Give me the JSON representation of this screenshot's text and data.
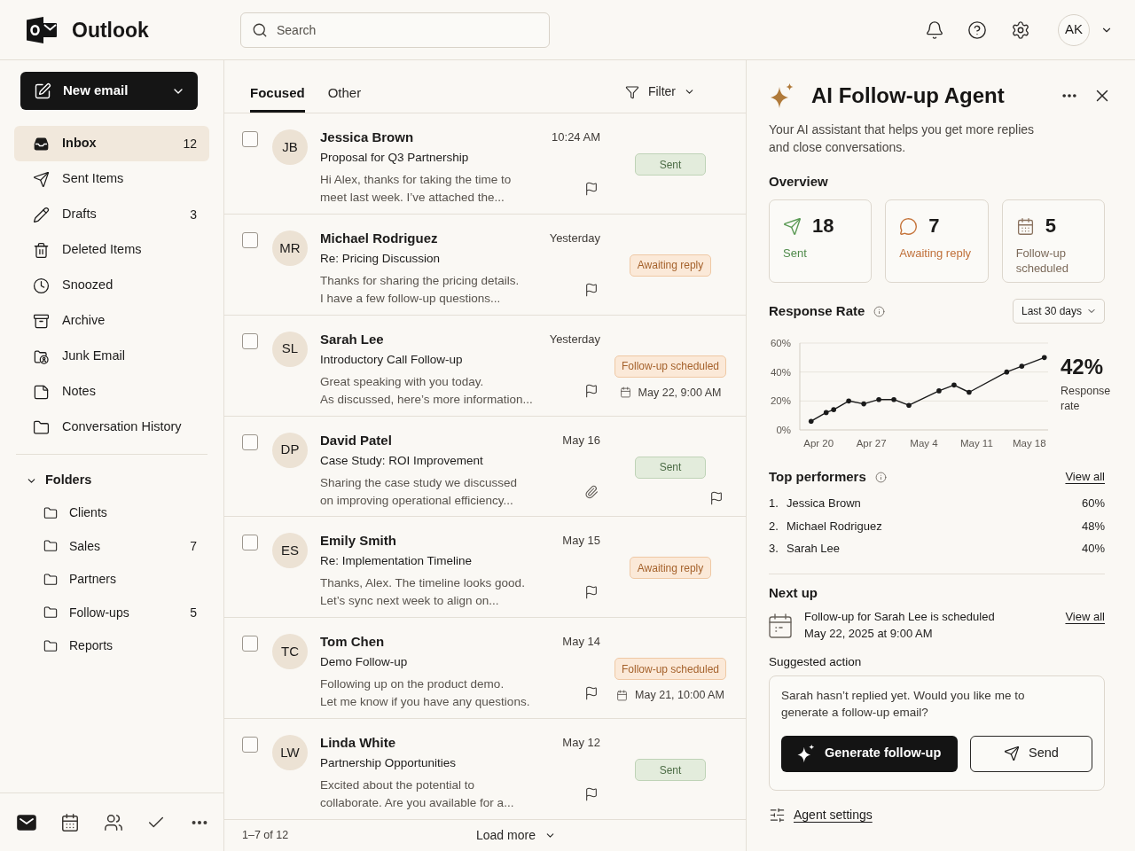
{
  "app": {
    "name": "Outlook"
  },
  "search": {
    "placeholder": "Search"
  },
  "user": {
    "initials": "AK"
  },
  "sidebar": {
    "new_email": "New email",
    "items": [
      {
        "kind": "inbox",
        "label": "Inbox",
        "count": "12",
        "selected": true
      },
      {
        "kind": "sent",
        "label": "Sent Items",
        "selected": false
      },
      {
        "kind": "drafts",
        "label": "Drafts",
        "count": "3",
        "selected": false
      },
      {
        "kind": "deleted",
        "label": "Deleted Items",
        "selected": false
      },
      {
        "kind": "snoozed",
        "label": "Snoozed",
        "selected": false
      },
      {
        "kind": "archive",
        "label": "Archive",
        "selected": false
      },
      {
        "kind": "junk",
        "label": "Junk Email",
        "selected": false
      },
      {
        "kind": "notes",
        "label": "Notes",
        "selected": false
      },
      {
        "kind": "history",
        "label": "Conversation History",
        "selected": false
      }
    ],
    "folders": {
      "label": "Folders",
      "expanded": true,
      "items": [
        {
          "label": "Clients",
          "selected": false
        },
        {
          "label": "Sales",
          "count": "7",
          "selected": false
        },
        {
          "label": "Partners",
          "selected": false
        },
        {
          "label": "Follow-ups",
          "count": "5",
          "selected": false
        },
        {
          "label": "Reports",
          "selected": false
        }
      ]
    },
    "app_bar": [
      {
        "kind": "mail",
        "selected": true
      },
      {
        "kind": "calendar",
        "selected": false
      },
      {
        "kind": "people",
        "selected": false
      },
      {
        "kind": "tasks",
        "selected": false
      },
      {
        "kind": "more",
        "selected": false
      }
    ]
  },
  "mail_list": {
    "tabs": [
      {
        "label": "Focused",
        "selected": true
      },
      {
        "label": "Other",
        "selected": false
      }
    ],
    "filter": "Filter",
    "messages": [
      {
        "initials": "JB",
        "sender": "Jessica Brown",
        "time": "10:24 AM",
        "subject": "Proposal for Q3 Partnership",
        "preview": [
          "Hi Alex, thanks for taking the time to",
          "meet last week. I’ve attached the..."
        ],
        "checked": false,
        "attachment": false,
        "status": {
          "kind": "sent",
          "label": "Sent"
        }
      },
      {
        "initials": "MR",
        "sender": "Michael Rodriguez",
        "time": "Yesterday",
        "subject": "Re: Pricing Discussion",
        "preview": [
          "Thanks for sharing the pricing details.",
          "I have a few follow-up questions..."
        ],
        "checked": false,
        "attachment": false,
        "status": {
          "kind": "awaiting",
          "label": "Awaiting reply"
        }
      },
      {
        "initials": "SL",
        "sender": "Sarah Lee",
        "time": "Yesterday",
        "subject": "Introductory Call Follow-up",
        "preview": [
          "Great speaking with you today.",
          "As discussed, here’s more information..."
        ],
        "checked": false,
        "attachment": false,
        "status": {
          "kind": "scheduled",
          "label": "Follow-up scheduled",
          "date": "May 22, 9:00 AM"
        }
      },
      {
        "initials": "DP",
        "sender": "David Patel",
        "time": "May 16",
        "subject": "Case Study: ROI Improvement",
        "preview": [
          "Sharing the case study we discussed",
          "on improving operational efficiency..."
        ],
        "checked": false,
        "attachment": true,
        "status": {
          "kind": "sent",
          "label": "Sent"
        }
      },
      {
        "initials": "ES",
        "sender": "Emily Smith",
        "time": "May 15",
        "subject": "Re: Implementation Timeline",
        "preview": [
          "Thanks, Alex. The timeline looks good.",
          "Let’s sync next week to align on..."
        ],
        "checked": false,
        "attachment": false,
        "status": {
          "kind": "awaiting",
          "label": "Awaiting reply"
        }
      },
      {
        "initials": "TC",
        "sender": "Tom Chen",
        "time": "May 14",
        "subject": "Demo Follow-up",
        "preview": [
          "Following up on the product demo.",
          "Let me know if you have any questions."
        ],
        "checked": false,
        "attachment": false,
        "status": {
          "kind": "scheduled",
          "label": "Follow-up scheduled",
          "date": "May 21, 10:00 AM"
        }
      },
      {
        "initials": "LW",
        "sender": "Linda White",
        "time": "May 12",
        "subject": "Partnership Opportunities",
        "preview": [
          "Excited about the potential to",
          "collaborate. Are you available for a..."
        ],
        "checked": false,
        "attachment": false,
        "status": {
          "kind": "sent",
          "label": "Sent"
        }
      }
    ],
    "range": "1–7 of 12",
    "load_more": "Load more"
  },
  "agent": {
    "title": "AI Follow-up Agent",
    "description": "Your AI assistant that helps you get more replies and close conversations.",
    "overview": {
      "title": "Overview",
      "cards": [
        {
          "kind": "sent",
          "value": "18",
          "label": "Sent"
        },
        {
          "kind": "awaiting",
          "value": "7",
          "label": "Awaiting reply"
        },
        {
          "kind": "scheduled",
          "value": "5",
          "label": "Follow-up scheduled"
        }
      ]
    },
    "response_rate": {
      "title": "Response Rate",
      "period": "Last 30 days",
      "current": "42%",
      "current_label": "Response rate",
      "chart_data": {
        "type": "line",
        "categories": [
          null,
          null,
          "Apr 20",
          null,
          null,
          null,
          null,
          null,
          null,
          "Apr 27",
          null,
          null,
          null,
          null,
          null,
          null,
          "May 4",
          null,
          null,
          null,
          null,
          null,
          null,
          "May 11",
          null,
          null,
          null,
          null,
          null,
          null,
          "May 18",
          null,
          null
        ],
        "series": [
          {
            "color": "#1a1a1a",
            "values": [
              null,
              6,
              null,
              12,
              14,
              null,
              20,
              null,
              18,
              null,
              21,
              null,
              21,
              null,
              17,
              null,
              null,
              null,
              27,
              null,
              31,
              null,
              26,
              null,
              null,
              null,
              null,
              40,
              null,
              44,
              null,
              null,
              50
            ]
          }
        ],
        "ylim": [
          0,
          60
        ],
        "yticks": [
          {
            "value": 0,
            "label": "0%"
          },
          {
            "value": 20,
            "label": "20%"
          },
          {
            "value": 40,
            "label": "40%"
          },
          {
            "value": 60,
            "label": "60%"
          }
        ]
      }
    },
    "top_performers": {
      "title": "Top performers",
      "link": "View all",
      "items": [
        {
          "rank": "1.",
          "name": "Jessica Brown",
          "rate": "60%"
        },
        {
          "rank": "2.",
          "name": "Michael Rodriguez",
          "rate": "48%"
        },
        {
          "rank": "3.",
          "name": "Sarah Lee",
          "rate": "40%"
        }
      ]
    },
    "next_up": {
      "title": "Next up",
      "text": "Follow-up for Sarah Lee is scheduled",
      "when": "May 22, 2025 at 9:00 AM",
      "link": "View all"
    },
    "suggested_action": {
      "title": "Suggested action",
      "message": "Sarah hasn’t replied yet. Would you like me to generate a follow-up email?",
      "primary": "Generate follow-up",
      "secondary": "Send"
    },
    "settings_link": "Agent settings"
  }
}
